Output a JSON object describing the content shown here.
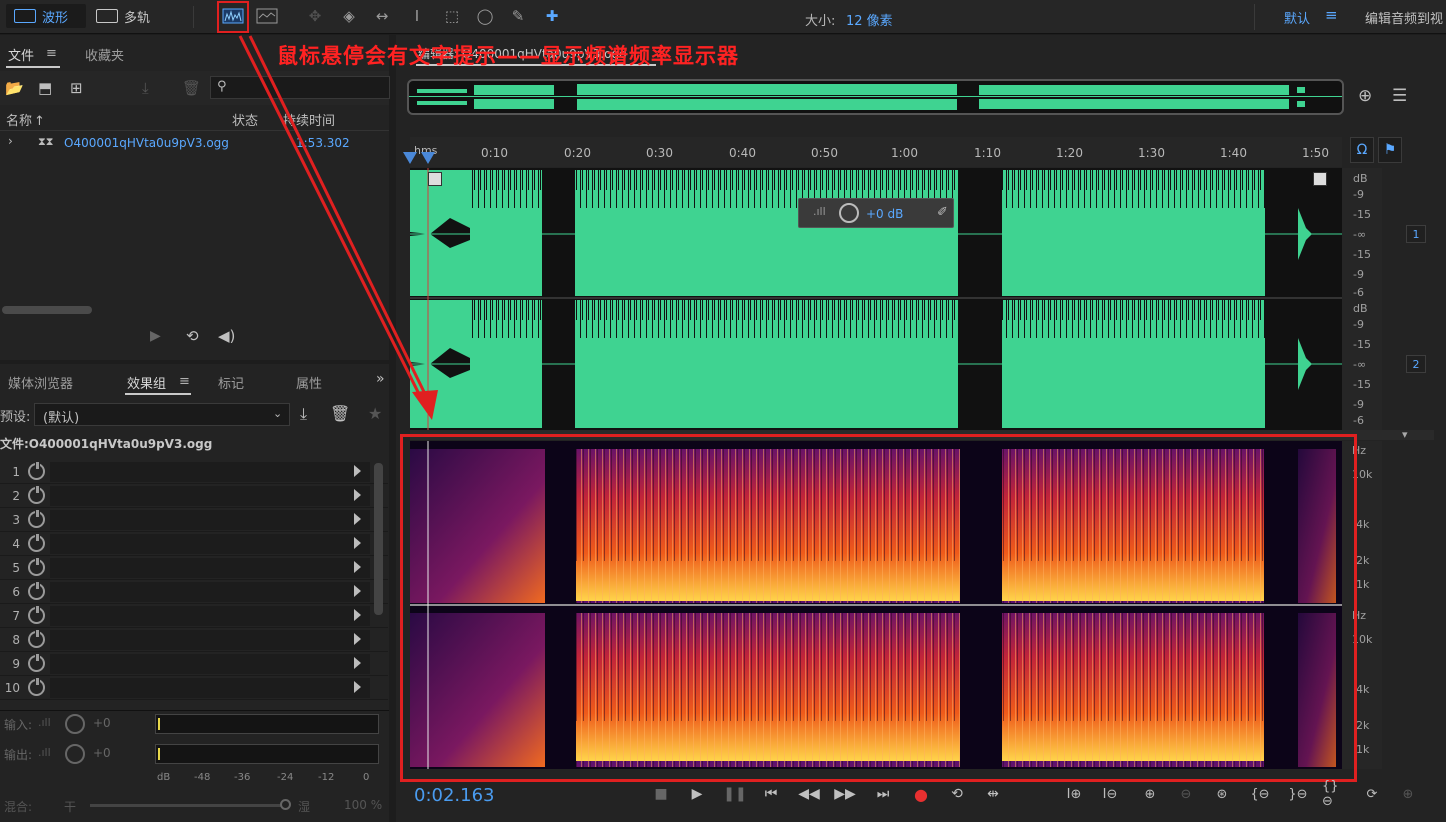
{
  "toolbar": {
    "waveform_label": "波形",
    "multitrack_label": "多轨",
    "size_label": "大小:",
    "size_value": "12 像素",
    "workspace": "默认",
    "workspace_menu_icon": "≡",
    "edit_link": "编辑音频到视"
  },
  "annotation": {
    "text": "鼠标悬停会有文字提示——显示频谱频率显示器",
    "color": "#ff2222"
  },
  "files_panel": {
    "tab_files": "文件",
    "tab_favorites": "收藏夹",
    "col_name": "名称",
    "col_status": "状态",
    "col_duration": "持续时间",
    "file_name": "O400001qHVta0u9pV3.ogg",
    "file_duration": "1:53.302"
  },
  "effects_panel": {
    "tabs": [
      "媒体浏览器",
      "效果组",
      "标记",
      "属性"
    ],
    "active_tab": "效果组",
    "preset_label": "预设:",
    "preset_value": "(默认)",
    "file_label": "文件:O400001qHVta0u9pV3.ogg",
    "slots": [
      "1",
      "2",
      "3",
      "4",
      "5",
      "6",
      "7",
      "8",
      "9",
      "10"
    ],
    "input_label": "输入:",
    "output_label": "输出:",
    "gain_in": "+0",
    "gain_out": "+0",
    "meter_scale": [
      "dB",
      "-48",
      "-36",
      "-24",
      "-12",
      "0"
    ],
    "mix_label": "混合:",
    "mix_dry": "干",
    "mix_wet": "湿",
    "mix_value": "100 %"
  },
  "editor": {
    "tab_title": "编辑器: O400001qHVta0u9pV3.ogg",
    "ruler_unit": "hms",
    "ruler_ticks": [
      "0:10",
      "0:20",
      "0:30",
      "0:40",
      "0:50",
      "1:00",
      "1:10",
      "1:20",
      "1:30",
      "1:40",
      "1:50"
    ],
    "hud_gain": "+0 dB",
    "db_scale_ch1": [
      "dB",
      "-9",
      "-15",
      "-∞",
      "-15",
      "-9",
      "-6"
    ],
    "db_scale_ch2": [
      "dB",
      "-9",
      "-15",
      "-∞",
      "-15",
      "-9",
      "-6"
    ],
    "hz_scale_ch1": [
      "Hz",
      "10k",
      "4k",
      "2k",
      "1k"
    ],
    "hz_scale_ch2": [
      "Hz",
      "10k",
      "4k",
      "2k",
      "1k"
    ],
    "channel_1": "1",
    "channel_2": "2",
    "time_display": "0:02.163",
    "waveform_color": "#3fd391",
    "accent": "#5aa8ff"
  }
}
